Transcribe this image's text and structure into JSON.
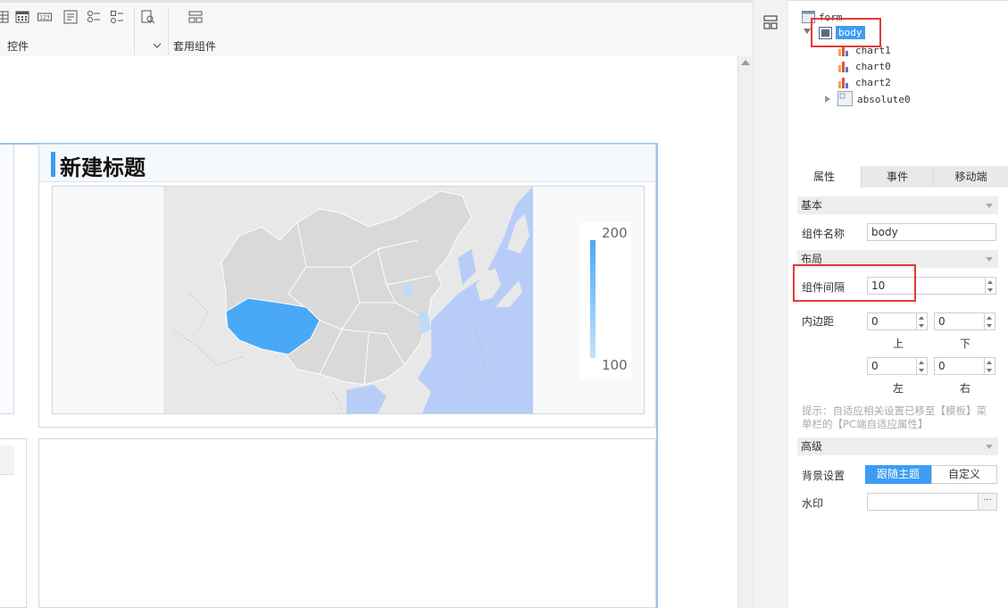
{
  "toolbar": {
    "controls_label": "控件",
    "common_label": "套用组件"
  },
  "canvas": {
    "title": "新建标题",
    "legend_max": "200",
    "legend_min": "100"
  },
  "tree": {
    "root": "form",
    "selected": "body",
    "children": [
      "chart1",
      "chart0",
      "chart2"
    ],
    "group": "absolute0"
  },
  "tabs": [
    "属性",
    "事件",
    "移动端"
  ],
  "props": {
    "basic_section": "基本",
    "name_label": "组件名称",
    "name_value": "body",
    "layout_section": "布局",
    "gap_label": "组件间隔",
    "gap_value": "10",
    "padding_label": "内边距",
    "pad_top_value": "0",
    "pad_bottom_value": "0",
    "pad_left_value": "0",
    "pad_right_value": "0",
    "top_label": "上",
    "bottom_label": "下",
    "left_label": "左",
    "right_label": "右",
    "hint_line1": "提示：自适应相关设置已移至【模板】菜",
    "hint_line2": "单栏的【PC端自适应属性】",
    "advanced_section": "高级",
    "bg_label": "背景设置",
    "bg_follow": "跟随主题",
    "bg_custom": "自定义",
    "watermark_label": "水印",
    "watermark_btn": "···"
  },
  "colors": {
    "accent": "#3d9df5",
    "map_highlight": "#4aa9f7",
    "map_land": "#e1e1e1",
    "map_sea": "#b7cdf8",
    "highlight_box": "#e53935"
  }
}
